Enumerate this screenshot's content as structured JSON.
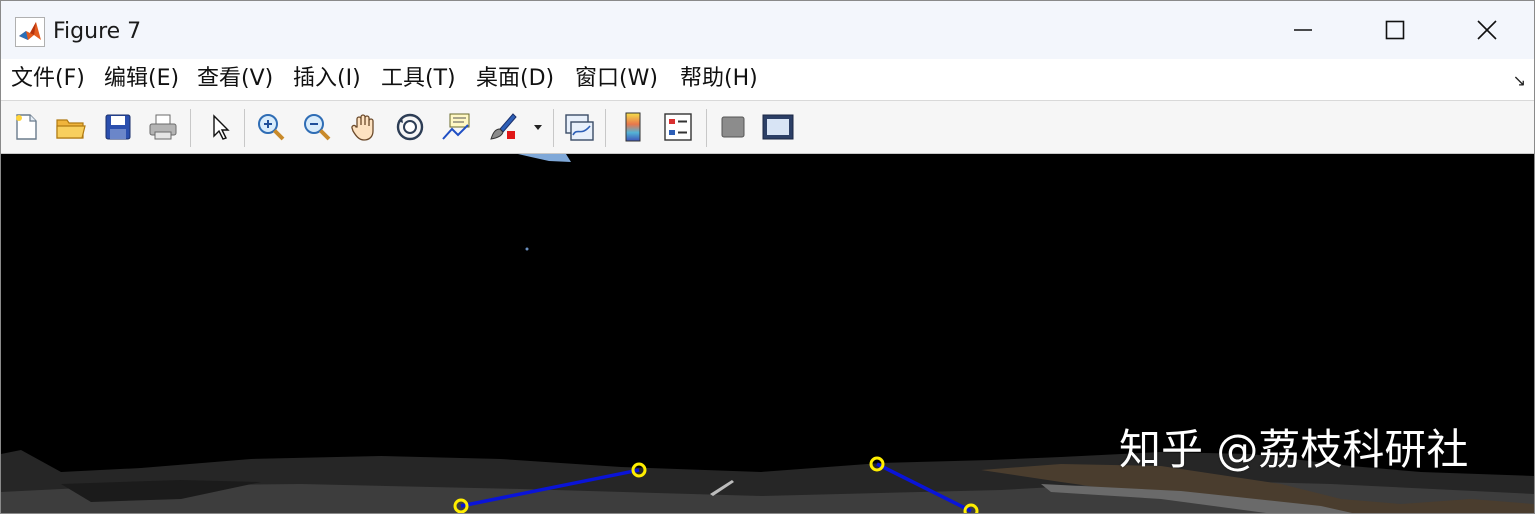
{
  "window": {
    "title": "Figure 7"
  },
  "menu": {
    "items": [
      {
        "label": "文件(F)"
      },
      {
        "label": "编辑(E)"
      },
      {
        "label": "查看(V)"
      },
      {
        "label": "插入(I)"
      },
      {
        "label": "工具(T)"
      },
      {
        "label": "桌面(D)"
      },
      {
        "label": "窗口(W)"
      },
      {
        "label": "帮助(H)"
      }
    ],
    "dock_icon": "dock-arrow-icon"
  },
  "toolbar": {
    "buttons": [
      {
        "icon": "new-figure-icon"
      },
      {
        "icon": "open-file-icon"
      },
      {
        "icon": "save-icon"
      },
      {
        "icon": "print-icon"
      },
      {
        "icon": "edit-plot-cursor-icon"
      },
      {
        "icon": "zoom-in-icon"
      },
      {
        "icon": "zoom-out-icon"
      },
      {
        "icon": "pan-hand-icon"
      },
      {
        "icon": "rotate-3d-icon"
      },
      {
        "icon": "data-cursor-icon"
      },
      {
        "icon": "brush-icon"
      },
      {
        "icon": "link-plot-icon"
      },
      {
        "icon": "colorbar-icon"
      },
      {
        "icon": "legend-icon"
      },
      {
        "icon": "hide-plot-tools-icon"
      },
      {
        "icon": "show-plot-tools-icon"
      }
    ]
  },
  "figure": {
    "watermark": "知乎 @荔枝科研社",
    "line_color": "#0a14d8",
    "marker_color": "#ffee00",
    "background": "#000000"
  }
}
